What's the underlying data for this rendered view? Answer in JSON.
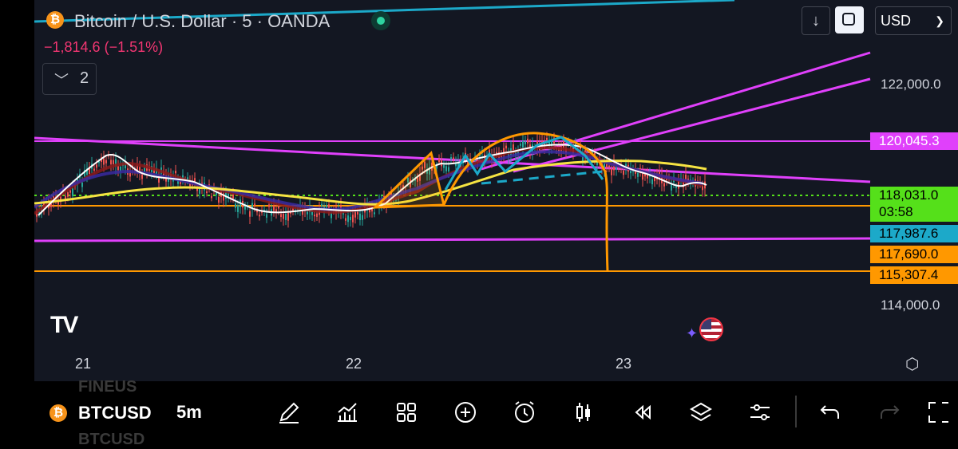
{
  "header": {
    "title": "Bitcoin / U.S. Dollar · 5 · OANDA",
    "coin_glyph": "₿",
    "change": "−1,814.6 (−1.51%)",
    "indicators_count": "2",
    "currency": "USD"
  },
  "price_axis": {
    "labels": [
      "122,000.0",
      "114,000.0"
    ],
    "tags": {
      "upper_resistance": "120,045.3",
      "last_price": "118,031.0",
      "countdown": "03:58",
      "cyan_level": "117,987.6",
      "orange_level_1": "117,690.0",
      "orange_level_2": "115,307.4"
    }
  },
  "time_axis": {
    "labels": [
      "21",
      "22",
      "23"
    ]
  },
  "branding": {
    "logo_text": "TV"
  },
  "toolbar": {
    "symbol": "BTCUSD",
    "timeframe": "5m",
    "ghost_above": "FINEUS",
    "ghost_below": "BTCUSD",
    "icons": [
      "draw-icon",
      "indicators-icon",
      "templates-icon",
      "add-icon",
      "alert-icon",
      "candle-type-icon",
      "replay-icon",
      "layers-icon",
      "settings-icon",
      "undo-icon",
      "redo-icon",
      "fullscreen-icon"
    ]
  },
  "colors": {
    "chart_bg": "#131722",
    "magenta": "#e040fb",
    "orange": "#ff9800",
    "cyan": "#1ca9c9",
    "yellow": "#f5e342",
    "green_tag": "#55e01a",
    "negative": "#f23672"
  }
}
